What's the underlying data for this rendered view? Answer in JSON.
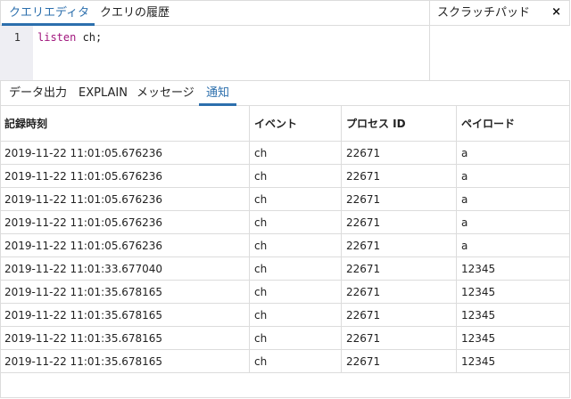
{
  "top_tabs": [
    "クエリエディタ",
    "クエリの履歴"
  ],
  "scratch": {
    "title": "スクラッチパッド",
    "close": "×"
  },
  "editor": {
    "line_number": "1",
    "keyword": "listen",
    "rest": " ch;"
  },
  "result_tabs": [
    "データ出力",
    "EXPLAIN",
    "メッセージ",
    "通知"
  ],
  "table": {
    "headers": [
      "記録時刻",
      "イベント",
      "プロセス ID",
      "ペイロード"
    ],
    "rows": [
      [
        "2019-11-22 11:01:05.676236",
        "ch",
        "22671",
        "a"
      ],
      [
        "2019-11-22 11:01:05.676236",
        "ch",
        "22671",
        "a"
      ],
      [
        "2019-11-22 11:01:05.676236",
        "ch",
        "22671",
        "a"
      ],
      [
        "2019-11-22 11:01:05.676236",
        "ch",
        "22671",
        "a"
      ],
      [
        "2019-11-22 11:01:05.676236",
        "ch",
        "22671",
        "a"
      ],
      [
        "2019-11-22 11:01:33.677040",
        "ch",
        "22671",
        "12345"
      ],
      [
        "2019-11-22 11:01:35.678165",
        "ch",
        "22671",
        "12345"
      ],
      [
        "2019-11-22 11:01:35.678165",
        "ch",
        "22671",
        "12345"
      ],
      [
        "2019-11-22 11:01:35.678165",
        "ch",
        "22671",
        "12345"
      ],
      [
        "2019-11-22 11:01:35.678165",
        "ch",
        "22671",
        "12345"
      ]
    ]
  }
}
